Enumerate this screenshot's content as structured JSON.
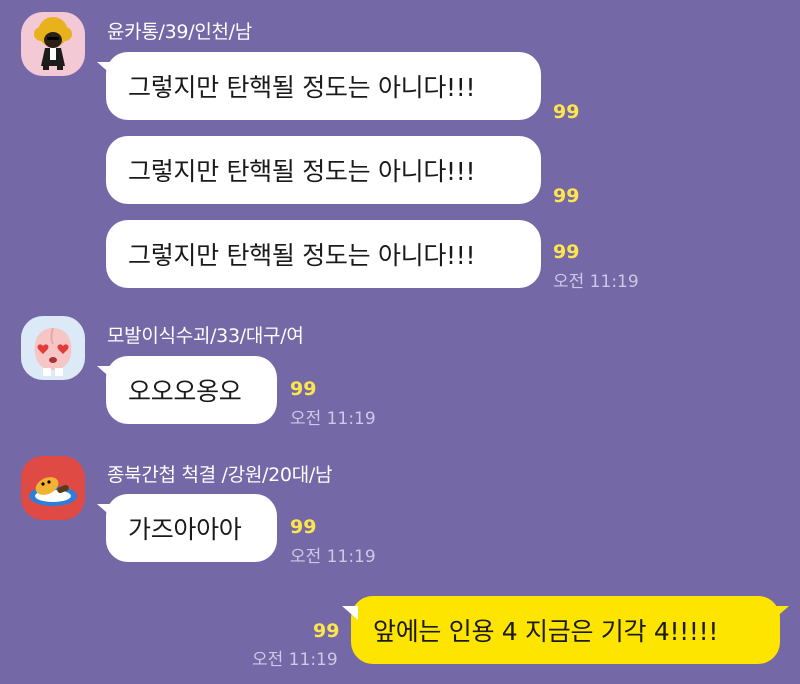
{
  "messages": [
    {
      "sender": "윤카통/39/인천/남",
      "avatar_icon": "afro-character-icon",
      "texts": [
        "그렇지만 탄핵될 정도는 아니다!!!",
        "그렇지만 탄핵될 정도는 아니다!!!",
        "그렇지만 탄핵될 정도는 아니다!!!"
      ],
      "unread": [
        "99",
        "99",
        "99"
      ],
      "time": "오전 11:19"
    },
    {
      "sender": "모발이식수괴/33/대구/여",
      "avatar_icon": "peach-heart-eyes-icon",
      "text": "오오오옹오",
      "unread": "99",
      "time": "오전 11:19"
    },
    {
      "sender": "종북간첩 척결 /강원/20대/남",
      "avatar_icon": "lying-character-icon",
      "text": "가즈아아아",
      "unread": "99",
      "time": "오전 11:19"
    }
  ],
  "my_message": {
    "text": "앞에는 인용 4 지금은 기각 4!!!!!",
    "unread": "99",
    "time": "오전 11:19"
  },
  "colors": {
    "background": "#7468a6",
    "bubble_other": "#ffffff",
    "bubble_me": "#fee500",
    "unread": "#fde54f"
  }
}
